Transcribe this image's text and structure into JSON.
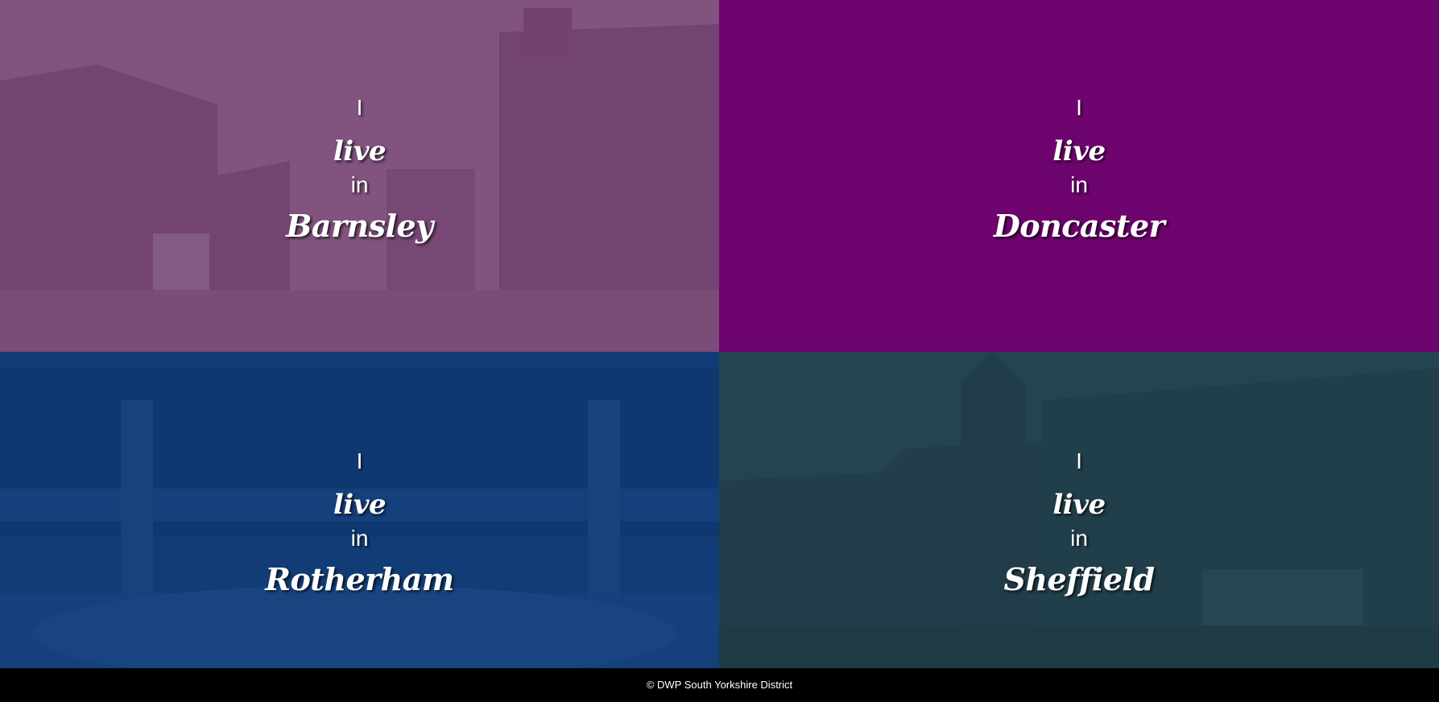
{
  "tiles": [
    {
      "pronoun": "I",
      "verb": "live",
      "preposition": "in",
      "city": "Barnsley",
      "tint": "#7a3f78"
    },
    {
      "pronoun": "I",
      "verb": "live",
      "preposition": "in",
      "city": "Doncaster",
      "tint": "#6e046e"
    },
    {
      "pronoun": "I",
      "verb": "live",
      "preposition": "in",
      "city": "Rotherham",
      "tint": "#0b3a78"
    },
    {
      "pronoun": "I",
      "verb": "live",
      "preposition": "in",
      "city": "Sheffield",
      "tint": "#1f4250"
    }
  ],
  "footer": {
    "text": "© DWP South Yorkshire District"
  }
}
